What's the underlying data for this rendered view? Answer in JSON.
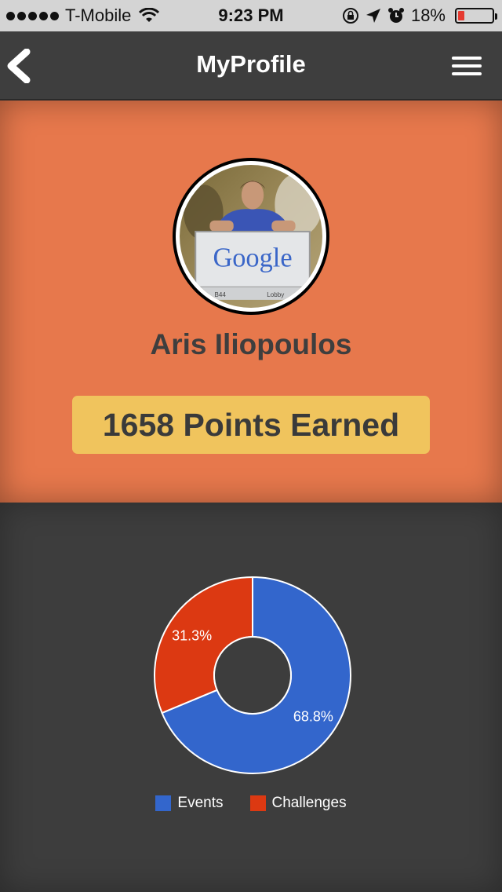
{
  "status_bar": {
    "carrier": "T-Mobile",
    "time": "9:23 PM",
    "battery": "18%"
  },
  "nav": {
    "title": "MyProfile"
  },
  "profile": {
    "name": "Aris Iliopoulos",
    "points_label": "1658 Points Earned",
    "photo_sign_text": "Google",
    "photo_sign_small_left": "B44",
    "photo_sign_small_right": "Lobby"
  },
  "colors": {
    "profile_bg": "#e7784c",
    "points_bg": "#f0c45d",
    "events": "#3366cc",
    "challenges": "#dc3912"
  },
  "chart_data": {
    "type": "pie",
    "donut": true,
    "categories": [
      "Events",
      "Challenges"
    ],
    "values": [
      68.8,
      31.3
    ],
    "labels": [
      "68.8%",
      "31.3%"
    ],
    "colors": [
      "#3366cc",
      "#dc3912"
    ],
    "legend_position": "bottom"
  }
}
